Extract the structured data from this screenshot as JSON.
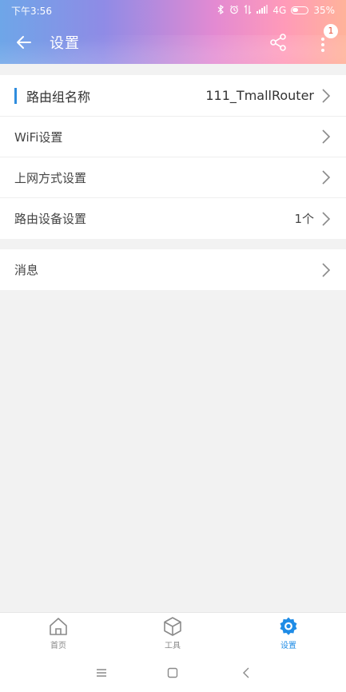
{
  "status_bar": {
    "time": "下午3:56",
    "signal_text": "4G",
    "battery": "35%"
  },
  "header": {
    "title": "设置",
    "badge_count": "1"
  },
  "settings_group": [
    {
      "label": "路由组名称",
      "value": "111_TmallRouter"
    },
    {
      "label": "WiFi设置",
      "value": ""
    },
    {
      "label": "上网方式设置",
      "value": ""
    },
    {
      "label": "路由设备设置",
      "value": "1个"
    }
  ],
  "message_group": [
    {
      "label": "消息",
      "value": ""
    }
  ],
  "bottom_nav": {
    "items": [
      {
        "label": "首页",
        "icon": "home-icon",
        "active": false
      },
      {
        "label": "工具",
        "icon": "cube-icon",
        "active": false
      },
      {
        "label": "设置",
        "icon": "gear-icon",
        "active": true
      }
    ]
  },
  "colors": {
    "accent": "#2f8dde",
    "active_nav": "#1f8ce6",
    "badge_text": "#e8503a",
    "header_gradient": [
      "#6ea6e8",
      "#8f8be6",
      "#e38ad2",
      "#ff9ab9",
      "#ffb39a"
    ]
  }
}
